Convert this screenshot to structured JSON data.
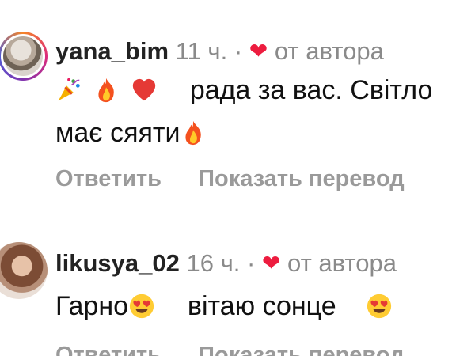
{
  "comments": [
    {
      "username": "yana_bim",
      "time": "11 ч.",
      "separator": "·",
      "liked_by_author": "от автора",
      "emoji_names": [
        "party-popper-icon",
        "fire-icon",
        "red-heart-icon"
      ],
      "text_part_1": "рада за вас. Світло",
      "text_part_2": "має сяяти",
      "actions": {
        "reply": "Ответить",
        "translate": "Показать перевод"
      }
    },
    {
      "username": "likusya_02",
      "time": "16 ч.",
      "separator": "·",
      "liked_by_author": "от автора",
      "emoji_names": [
        "smiling-face-heart-eyes-icon",
        "smiling-face-heart-eyes-icon"
      ],
      "text_part_1": "Гарно",
      "text_part_2": "вітаю сонце",
      "actions": {
        "reply": "Ответить",
        "translate": "Показать перевод"
      }
    }
  ],
  "colors": {
    "author_heart": "#ed1c3f",
    "meta_gray": "#8a8a8a",
    "action_gray": "#9a9a9a"
  }
}
